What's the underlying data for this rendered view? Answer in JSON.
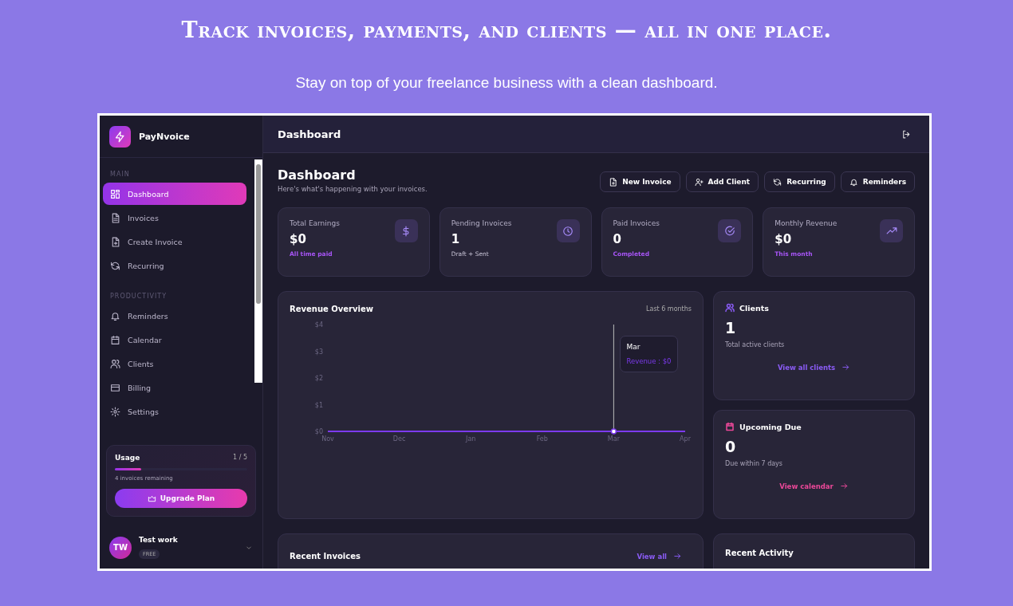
{
  "headline": "Track invoices, payments, and clients — all in one place.",
  "subheadline": "Stay on top of your freelance business with a clean dashboard.",
  "app": {
    "brand": "PayNvoice",
    "sidebar": {
      "sections": [
        {
          "label": "MAIN",
          "items": [
            {
              "label": "Dashboard",
              "selected": true
            },
            {
              "label": "Invoices",
              "selected": false
            },
            {
              "label": "Create Invoice",
              "selected": false
            },
            {
              "label": "Recurring",
              "selected": false
            }
          ]
        },
        {
          "label": "PRODUCTIVITY",
          "items": [
            {
              "label": "Reminders",
              "selected": false
            },
            {
              "label": "Calendar",
              "selected": false
            },
            {
              "label": "Clients",
              "selected": false
            },
            {
              "label": "Billing",
              "selected": false
            },
            {
              "label": "Settings",
              "selected": false
            }
          ]
        }
      ],
      "usage": {
        "title": "Usage",
        "count": "1 / 5",
        "level": 0.2,
        "remaining": "4 invoices remaining",
        "button": "Upgrade Plan"
      },
      "user": {
        "initials": "TW",
        "name": "Test work",
        "plan": "FREE"
      }
    },
    "topbar": {
      "title": "Dashboard"
    },
    "page": {
      "title": "Dashboard",
      "subtitle": "Here's what's happening with your invoices.",
      "actions": [
        "New Invoice",
        "Add Client",
        "Recurring",
        "Reminders"
      ]
    },
    "stats": [
      {
        "title": "Total Earnings",
        "value": "$0",
        "note": "All time paid",
        "accent": true
      },
      {
        "title": "Pending Invoices",
        "value": "1",
        "note": "Draft + Sent",
        "accent": false
      },
      {
        "title": "Paid Invoices",
        "value": "0",
        "note": "Completed",
        "accent": true
      },
      {
        "title": "Monthly Revenue",
        "value": "$0",
        "note": "This month",
        "accent": true
      }
    ],
    "revenue": {
      "title": "Revenue Overview",
      "range": "Last 6 months",
      "chart_data": {
        "type": "line",
        "categories": [
          "Nov",
          "Dec",
          "Jan",
          "Feb",
          "Mar",
          "Apr"
        ],
        "series": [
          {
            "color": "#7c3aed",
            "values": [
              0,
              0,
              0,
              0,
              0,
              0
            ]
          }
        ],
        "ylim": [
          0,
          4
        ],
        "yticks": [
          {
            "value": 0,
            "label": "$0"
          },
          {
            "value": 1,
            "label": "$1"
          },
          {
            "value": 2,
            "label": "$2"
          },
          {
            "value": 3,
            "label": "$3"
          },
          {
            "value": 4,
            "label": "$4"
          }
        ]
      },
      "tooltip": {
        "month": "Mar",
        "text": "Revenue : $0"
      }
    },
    "side_cards": [
      {
        "title": "Clients",
        "value": "1",
        "note": "Total active clients",
        "link": "View all clients",
        "color": "#8b5cf6"
      },
      {
        "title": "Upcoming Due",
        "value": "0",
        "note": "Due within 7 days",
        "link": "View calendar",
        "color": "#ec4899"
      }
    ],
    "recent_invoices": {
      "title": "Recent Invoices",
      "link": "View all"
    },
    "recent_activity": {
      "title": "Recent Activity"
    }
  }
}
